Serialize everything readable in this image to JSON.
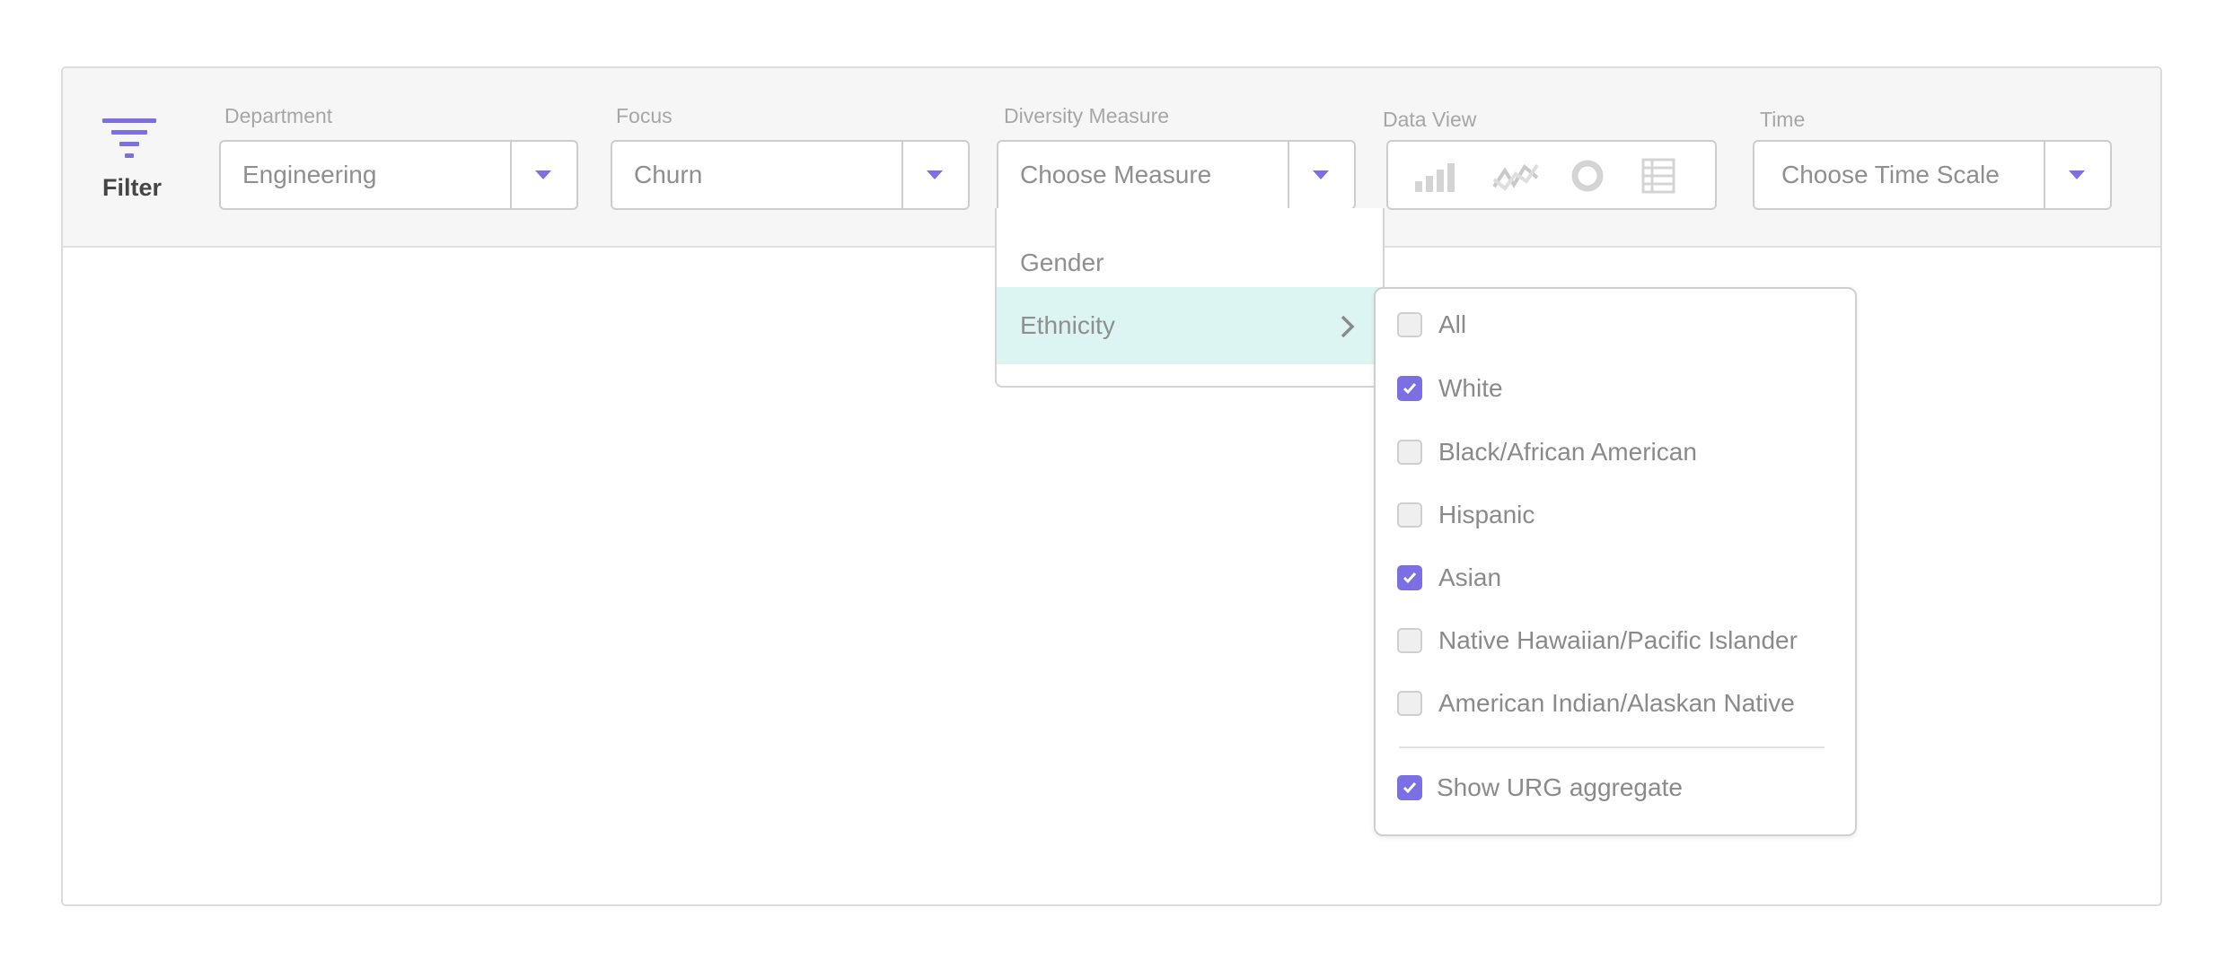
{
  "filter": {
    "label": "Filter"
  },
  "department": {
    "label": "Department",
    "value": "Engineering"
  },
  "focus": {
    "label": "Focus",
    "value": "Churn"
  },
  "diversity": {
    "label": "Diversity Measure",
    "value": "Choose Measure",
    "menu": [
      {
        "label": "Gender"
      },
      {
        "label": "Ethnicity"
      }
    ]
  },
  "dataview": {
    "label": "Data View",
    "icons": [
      "bar-chart-icon",
      "line-chart-icon",
      "donut-chart-icon",
      "table-icon"
    ]
  },
  "time": {
    "label": "Time",
    "value": "Choose Time Scale"
  },
  "ethnicity": {
    "options": [
      {
        "label": "All",
        "checked": false
      },
      {
        "label": "White",
        "checked": true
      },
      {
        "label": "Black/African American",
        "checked": false
      },
      {
        "label": "Hispanic",
        "checked": false
      },
      {
        "label": "Asian",
        "checked": true
      },
      {
        "label": "Native Hawaiian/Pacific Islander",
        "checked": false
      },
      {
        "label": "American Indian/Alaskan Native",
        "checked": false
      }
    ],
    "aggregate": {
      "label": "Show URG aggregate",
      "checked": true
    }
  },
  "colors": {
    "accent": "#7b6fe3",
    "highlight": "#dcf5f2",
    "topbar": "#f6f6f6"
  }
}
